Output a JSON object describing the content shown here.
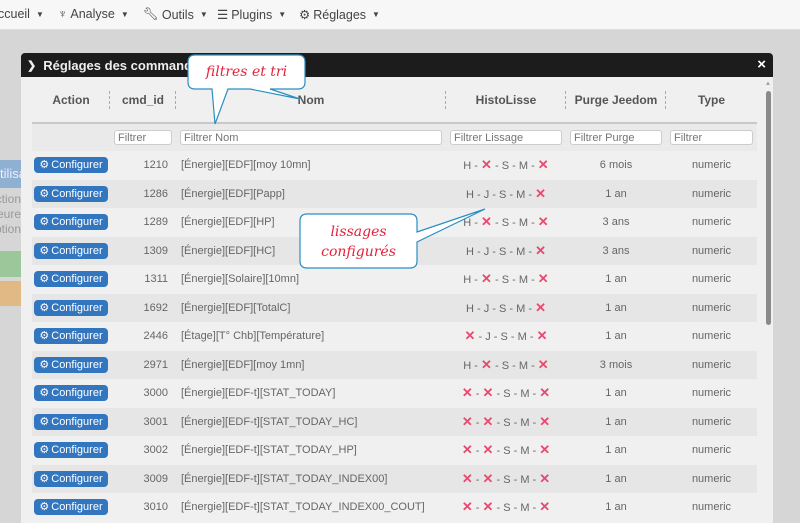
{
  "nav": [
    {
      "label": "ccueil",
      "icon": ""
    },
    {
      "label": "Analyse",
      "icon": "stethoscope-icon"
    },
    {
      "label": "Outils",
      "icon": "wrench-icon"
    },
    {
      "label": "Plugins",
      "icon": "list-icon"
    },
    {
      "label": "Réglages",
      "icon": "gear-icon"
    }
  ],
  "background": {
    "title": "tilisa",
    "lines": [
      "ction",
      "heure",
      "ption"
    ]
  },
  "modal": {
    "title": "Réglages des commandes",
    "close": "×"
  },
  "columns": [
    "Action",
    "cmd_id",
    "Nom",
    "HistoLisse",
    "Purge Jeedom",
    "Type"
  ],
  "filters": {
    "cmd_id": "Filtrer",
    "nom": "Filtrer Nom",
    "histo": "Filtrer Lissage",
    "purge": "Filtrer Purge",
    "type": "Filtrer"
  },
  "button_label": "Configurer",
  "rows": [
    {
      "id": "1210",
      "nom": "[Énergie][EDF][moy 10mn]",
      "histo": [
        "H",
        "X",
        "S",
        "M",
        "X"
      ],
      "purge": "6 mois",
      "type": "numeric"
    },
    {
      "id": "1286",
      "nom": "[Énergie][EDF][Papp]",
      "histo": [
        "H",
        "J",
        "S",
        "M",
        "X"
      ],
      "purge": "1 an",
      "type": "numeric"
    },
    {
      "id": "1289",
      "nom": "[Énergie][EDF][HP]",
      "histo": [
        "H",
        "X",
        "S",
        "M",
        "X"
      ],
      "purge": "3 ans",
      "type": "numeric"
    },
    {
      "id": "1309",
      "nom": "[Énergie][EDF][HC]",
      "histo": [
        "H",
        "J",
        "S",
        "M",
        "X"
      ],
      "purge": "3 ans",
      "type": "numeric"
    },
    {
      "id": "1311",
      "nom": "[Énergie][Solaire][10mn]",
      "histo": [
        "H",
        "X",
        "S",
        "M",
        "X"
      ],
      "purge": "1 an",
      "type": "numeric"
    },
    {
      "id": "1692",
      "nom": "[Énergie][EDF][TotalC]",
      "histo": [
        "H",
        "J",
        "S",
        "M",
        "X"
      ],
      "purge": "1 an",
      "type": "numeric"
    },
    {
      "id": "2446",
      "nom": "[Étage][T° Chb][Température]",
      "histo": [
        "X",
        "J",
        "S",
        "M",
        "X"
      ],
      "purge": "1 an",
      "type": "numeric"
    },
    {
      "id": "2971",
      "nom": "[Énergie][EDF][moy 1mn]",
      "histo": [
        "H",
        "X",
        "S",
        "M",
        "X"
      ],
      "purge": "3 mois",
      "type": "numeric"
    },
    {
      "id": "3000",
      "nom": "[Énergie][EDF-t][STAT_TODAY]",
      "histo": [
        "X",
        "X",
        "S",
        "M",
        "X"
      ],
      "purge": "1 an",
      "type": "numeric"
    },
    {
      "id": "3001",
      "nom": "[Énergie][EDF-t][STAT_TODAY_HC]",
      "histo": [
        "X",
        "X",
        "S",
        "M",
        "X"
      ],
      "purge": "1 an",
      "type": "numeric"
    },
    {
      "id": "3002",
      "nom": "[Énergie][EDF-t][STAT_TODAY_HP]",
      "histo": [
        "X",
        "X",
        "S",
        "M",
        "X"
      ],
      "purge": "1 an",
      "type": "numeric"
    },
    {
      "id": "3009",
      "nom": "[Énergie][EDF-t][STAT_TODAY_INDEX00]",
      "histo": [
        "X",
        "X",
        "S",
        "M",
        "X"
      ],
      "purge": "1 an",
      "type": "numeric"
    },
    {
      "id": "3010",
      "nom": "[Énergie][EDF-t][STAT_TODAY_INDEX00_COUT]",
      "histo": [
        "X",
        "X",
        "S",
        "M",
        "X"
      ],
      "purge": "1 an",
      "type": "numeric"
    }
  ],
  "annotations": {
    "filters": "filtres et tri",
    "smoothing": [
      "lissages",
      "configurés"
    ]
  },
  "colors": {
    "button": "#3376c0",
    "cross": "#e84a6f",
    "titlebar": "#1c1c1c",
    "annotation": "#e8203a"
  }
}
